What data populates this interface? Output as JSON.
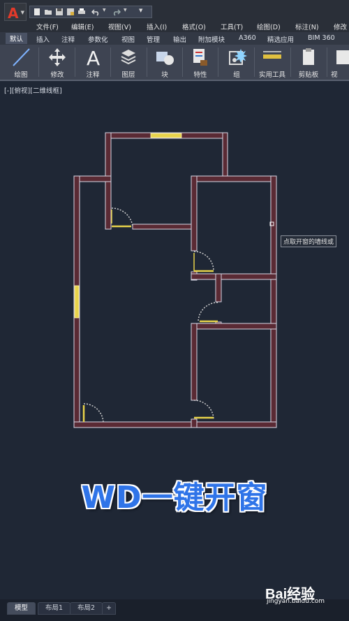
{
  "app": {
    "logo_letter": "A",
    "brand_color": "#e23a2b"
  },
  "menu": {
    "items": [
      "文件(F)",
      "编辑(E)",
      "视图(V)",
      "插入(I)",
      "格式(O)",
      "工具(T)",
      "绘图(D)",
      "标注(N)",
      "修改"
    ]
  },
  "ribbon_tabs": {
    "items": [
      "默认",
      "插入",
      "注释",
      "参数化",
      "视图",
      "管理",
      "输出",
      "附加模块",
      "A360",
      "精选应用",
      "BIM 360"
    ],
    "active": "默认"
  },
  "ribbon": {
    "buttons": [
      {
        "label": "绘图",
        "icon": "line-draw-icon"
      },
      {
        "label": "修改",
        "icon": "move-arrows-icon"
      },
      {
        "label": "注释",
        "icon": "text-annotation-icon"
      },
      {
        "label": "图层",
        "icon": "layers-icon"
      },
      {
        "label": "块",
        "icon": "block-insert-icon"
      },
      {
        "label": "特性",
        "icon": "properties-icon"
      },
      {
        "label": "组",
        "icon": "group-icon"
      },
      {
        "label": "实用工具",
        "icon": "measure-tool-icon"
      },
      {
        "label": "剪贴板",
        "icon": "clipboard-icon"
      },
      {
        "label": "视",
        "icon": "view-icon"
      }
    ]
  },
  "viewport": {
    "label": "[-][俯视][二维线框]"
  },
  "tooltip": {
    "text": "点取开窗的墙线或"
  },
  "caption": {
    "text": "WD一键开窗"
  },
  "layout_tabs": {
    "items": [
      "模型",
      "布局1",
      "布局2"
    ],
    "add_label": "+",
    "active": "模型"
  },
  "watermark": {
    "brand": "Bai经验",
    "sub": "jingyan.baidu.com"
  },
  "colors": {
    "wall": "#5a2a34",
    "wall_line": "#d9d9e8",
    "window": "#e8d34a",
    "door": "#e8d34a",
    "background": "#1f2735"
  }
}
